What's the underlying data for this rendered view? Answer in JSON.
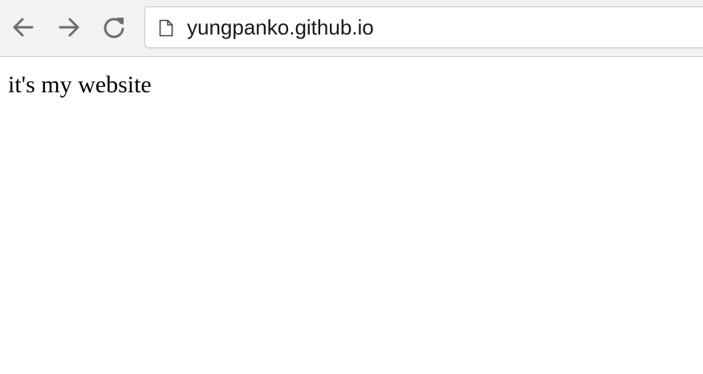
{
  "browser": {
    "toolbar": {
      "back_icon": "arrow-left-icon",
      "forward_icon": "arrow-right-icon",
      "reload_icon": "reload-icon",
      "page_icon": "document-icon",
      "icon_color": "#6e6e6e"
    },
    "address_bar": {
      "url": "yungpanko.github.io"
    }
  },
  "page": {
    "body_text": "it's my website"
  }
}
